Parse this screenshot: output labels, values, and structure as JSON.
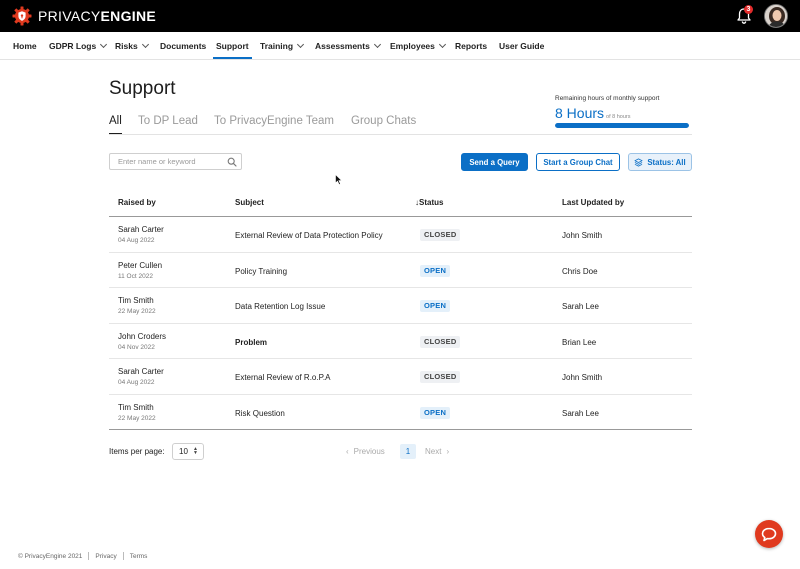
{
  "brand": {
    "logo_text_light": "PRIVACY",
    "logo_text_bold": "ENGINE",
    "accent": "#0b6fc6",
    "logo_color": "#e03a1f"
  },
  "header": {
    "notification_count": "3"
  },
  "nav": {
    "items": [
      {
        "label": "Home",
        "has_menu": false
      },
      {
        "label": "GDPR Logs",
        "has_menu": true
      },
      {
        "label": "Risks",
        "has_menu": true
      },
      {
        "label": "Documents",
        "has_menu": false
      },
      {
        "label": "Support",
        "has_menu": false,
        "active": true
      },
      {
        "label": "Training",
        "has_menu": true
      },
      {
        "label": "Assessments",
        "has_menu": true
      },
      {
        "label": "Employees",
        "has_menu": true
      },
      {
        "label": "Reports",
        "has_menu": false
      },
      {
        "label": "User Guide",
        "has_menu": false
      }
    ]
  },
  "page": {
    "title": "Support"
  },
  "support_hours": {
    "caption": "Remaining hours of monthly support",
    "value": "8 Hours",
    "of_total": "of 8 hours",
    "remaining_fraction": 1.0
  },
  "tabs": [
    {
      "label": "All",
      "active": true
    },
    {
      "label": "To DP Lead"
    },
    {
      "label": "To PrivacyEngine Team"
    },
    {
      "label": "Group Chats"
    }
  ],
  "toolbar": {
    "search_placeholder": "Enter name or keyword",
    "send_query_label": "Send a Query",
    "group_chat_label": "Start a Group Chat",
    "status_filter_label": "Status: All"
  },
  "table": {
    "columns": {
      "raised_by": "Raised by",
      "subject": "Subject",
      "status": "Status",
      "status_sort_arrow": "↓",
      "last_updated_by": "Last Updated by"
    },
    "rows": [
      {
        "name": "Sarah Carter",
        "date": "04 Aug 2022",
        "subject": "External Review of Data Protection Policy",
        "status": "CLOSED",
        "updated_by": "John Smith"
      },
      {
        "name": "Peter Cullen",
        "date": "11 Oct 2022",
        "subject": "Policy Training",
        "status": "OPEN",
        "updated_by": "Chris Doe"
      },
      {
        "name": "Tim Smith",
        "date": "22 May 2022",
        "subject": "Data Retention Log Issue",
        "status": "OPEN",
        "updated_by": "Sarah Lee"
      },
      {
        "name": "John Croders",
        "date": "04 Nov 2022",
        "subject": "Problem",
        "status": "CLOSED",
        "updated_by": "Brian Lee",
        "subject_bold": true
      },
      {
        "name": "Sarah Carter",
        "date": "04 Aug 2022",
        "subject": "External Review of R.o.P.A",
        "status": "CLOSED",
        "updated_by": "John Smith"
      },
      {
        "name": "Tim Smith",
        "date": "22 May 2022",
        "subject": "Risk Question",
        "status": "OPEN",
        "updated_by": "Sarah Lee"
      }
    ]
  },
  "pagination": {
    "items_per_page_label": "Items per page:",
    "items_per_page_value": "10",
    "previous_label": "Previous",
    "next_label": "Next",
    "current_page": "1"
  },
  "footer": {
    "copyright": "© PrivacyEngine 2021",
    "privacy_link": "Privacy",
    "terms_link": "Terms"
  }
}
